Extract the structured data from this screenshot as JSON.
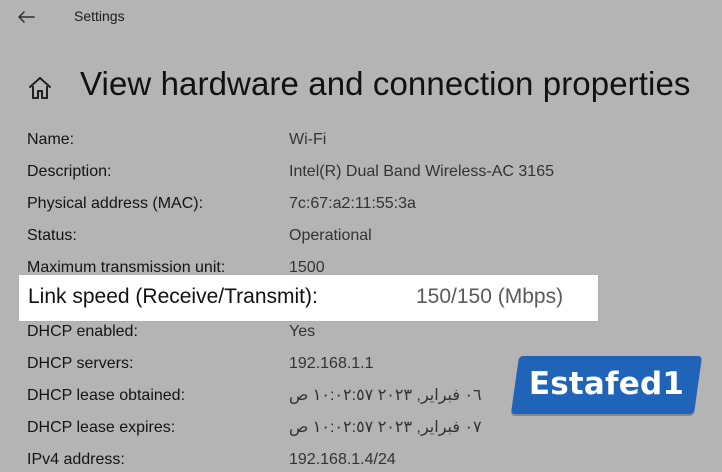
{
  "window": {
    "title": "Settings",
    "back_icon": "arrow-left-icon",
    "home_icon": "home-icon"
  },
  "page": {
    "title": "View hardware and connection properties"
  },
  "properties": [
    {
      "label": "Name:",
      "value": "Wi-Fi"
    },
    {
      "label": "Description:",
      "value": "Intel(R) Dual Band Wireless-AC 3165"
    },
    {
      "label": "Physical address (MAC):",
      "value": "7c:67:a2:11:55:3a"
    },
    {
      "label": "Status:",
      "value": "Operational"
    },
    {
      "label": "Maximum transmission unit:",
      "value": "1500"
    },
    {
      "label": "Link speed (Receive/Transmit):",
      "value": "150/150 (Mbps)"
    },
    {
      "label": "DHCP enabled:",
      "value": "Yes"
    },
    {
      "label": "DHCP servers:",
      "value": "192.168.1.1"
    },
    {
      "label": "DHCP lease obtained:",
      "value": "٠٦ فبراير, ٢٠٢٣ ١٠:٠٢:٥٧ ص"
    },
    {
      "label": "DHCP lease expires:",
      "value": "٠٧ فبراير, ٢٠٢٣ ١٠:٠٢:٥٧ ص"
    },
    {
      "label": "IPv4 address:",
      "value": "192.168.1.4/24"
    }
  ],
  "watermark": {
    "text": "Estafed1",
    "color": "#1f64b9"
  },
  "colors": {
    "background": "#b4b4b4",
    "highlight_bg": "#ffffff"
  }
}
